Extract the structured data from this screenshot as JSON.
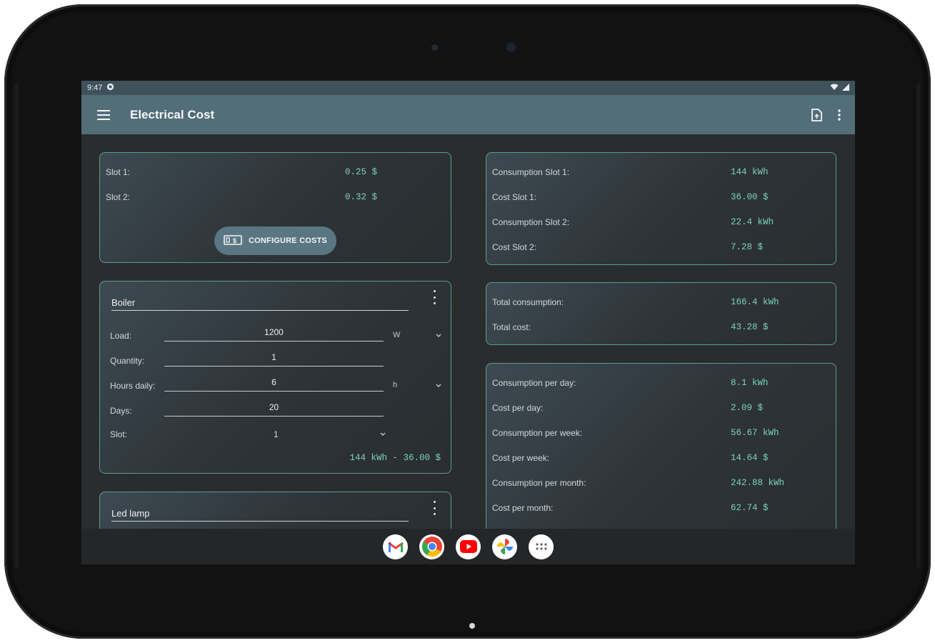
{
  "status": {
    "time": "9:47"
  },
  "appbar": {
    "title": "Electrical Cost"
  },
  "slots_card": {
    "rows": [
      {
        "label": "Slot 1:",
        "value": "0.25 $"
      },
      {
        "label": "Slot 2:",
        "value": "0.32 $"
      }
    ],
    "button_label": "CONFIGURE COSTS"
  },
  "devices": [
    {
      "name": "Boiler",
      "load_label": "Load:",
      "load_value": "1200",
      "load_unit": "W",
      "quantity_label": "Quantity:",
      "quantity_value": "1",
      "hours_label": "Hours daily:",
      "hours_value": "6",
      "hours_unit": "h",
      "days_label": "Days:",
      "days_value": "20",
      "slot_label": "Slot:",
      "slot_value": "1",
      "summary": "144 kWh - 36.00 $"
    },
    {
      "name": "Led lamp"
    }
  ],
  "consumption_card": {
    "rows": [
      {
        "label": "Consumption Slot 1:",
        "value": "144 kWh"
      },
      {
        "label": "Cost Slot 1:",
        "value": "36.00 $"
      },
      {
        "label": "Consumption Slot 2:",
        "value": "22.4 kWh"
      },
      {
        "label": "Cost Slot 2:",
        "value": "7.28 $"
      }
    ]
  },
  "total_card": {
    "rows": [
      {
        "label": "Total consumption:",
        "value": "166.4 kWh"
      },
      {
        "label": "Total cost:",
        "value": "43.28 $"
      }
    ]
  },
  "period_card": {
    "rows": [
      {
        "label": "Consumption per day:",
        "value": "8.1 kWh"
      },
      {
        "label": "Cost per day:",
        "value": "2.09 $"
      },
      {
        "label": "Consumption per week:",
        "value": "56.67 kWh"
      },
      {
        "label": "Cost per week:",
        "value": "14.64 $"
      },
      {
        "label": "Consumption per month:",
        "value": "242.88 kWh"
      },
      {
        "label": "Cost per month:",
        "value": "62.74 $"
      }
    ]
  },
  "dock": {
    "apps": [
      "gmail-icon",
      "chrome-icon",
      "youtube-icon",
      "photos-icon",
      "app-drawer-icon"
    ]
  },
  "colors": {
    "accent": "#7cd3bd",
    "border": "#5a9c8e",
    "appbar": "#536d79"
  }
}
